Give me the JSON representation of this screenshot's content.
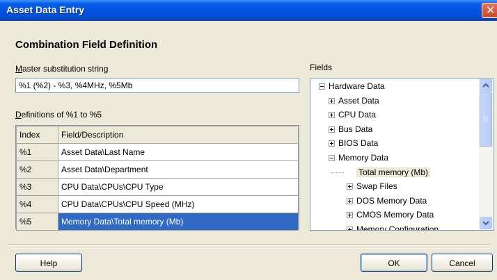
{
  "window": {
    "title": "Asset Data Entry",
    "close_glyph": "✕"
  },
  "heading": "Combination Field Definition",
  "master": {
    "label_accel": "M",
    "label_rest": "aster substitution string",
    "value": "%1 (%2) - %3, %4MHz, %5Mb"
  },
  "definitions": {
    "label_accel": "D",
    "label_rest": "efinitions of %1 to %5",
    "headers": {
      "index": "Index",
      "field": "Field/Description"
    },
    "rows": [
      {
        "index": "%1",
        "field": "Asset Data\\Last Name"
      },
      {
        "index": "%2",
        "field": "Asset Data\\Department"
      },
      {
        "index": "%3",
        "field": "CPU Data\\CPUs\\CPU Type"
      },
      {
        "index": "%4",
        "field": "CPU Data\\CPUs\\CPU Speed (MHz)"
      },
      {
        "index": "%5",
        "field": "Memory Data\\Total memory (Mb)",
        "selected": true
      }
    ]
  },
  "fields": {
    "label": "Fields",
    "tree": [
      {
        "label": "Hardware Data",
        "state": "collapse"
      },
      {
        "label": "Asset Data",
        "state": "expand"
      },
      {
        "label": "CPU Data",
        "state": "expand"
      },
      {
        "label": "Bus Data",
        "state": "expand"
      },
      {
        "label": "BIOS Data",
        "state": "expand"
      },
      {
        "label": "Memory Data",
        "state": "collapse"
      },
      {
        "label": "Total memory (Mb)",
        "state": "leaf",
        "highlighted": true
      },
      {
        "label": "Swap Files",
        "state": "expand"
      },
      {
        "label": "DOS Memory Data",
        "state": "expand"
      },
      {
        "label": "CMOS Memory Data",
        "state": "expand"
      },
      {
        "label": "Memory Configuration",
        "state": "expand"
      }
    ]
  },
  "buttons": {
    "help": "Help",
    "ok": "OK",
    "cancel": "Cancel"
  },
  "colors": {
    "titlebar": "#0054e3",
    "selection": "#316ac5",
    "dialog_bg": "#ece9d8"
  }
}
